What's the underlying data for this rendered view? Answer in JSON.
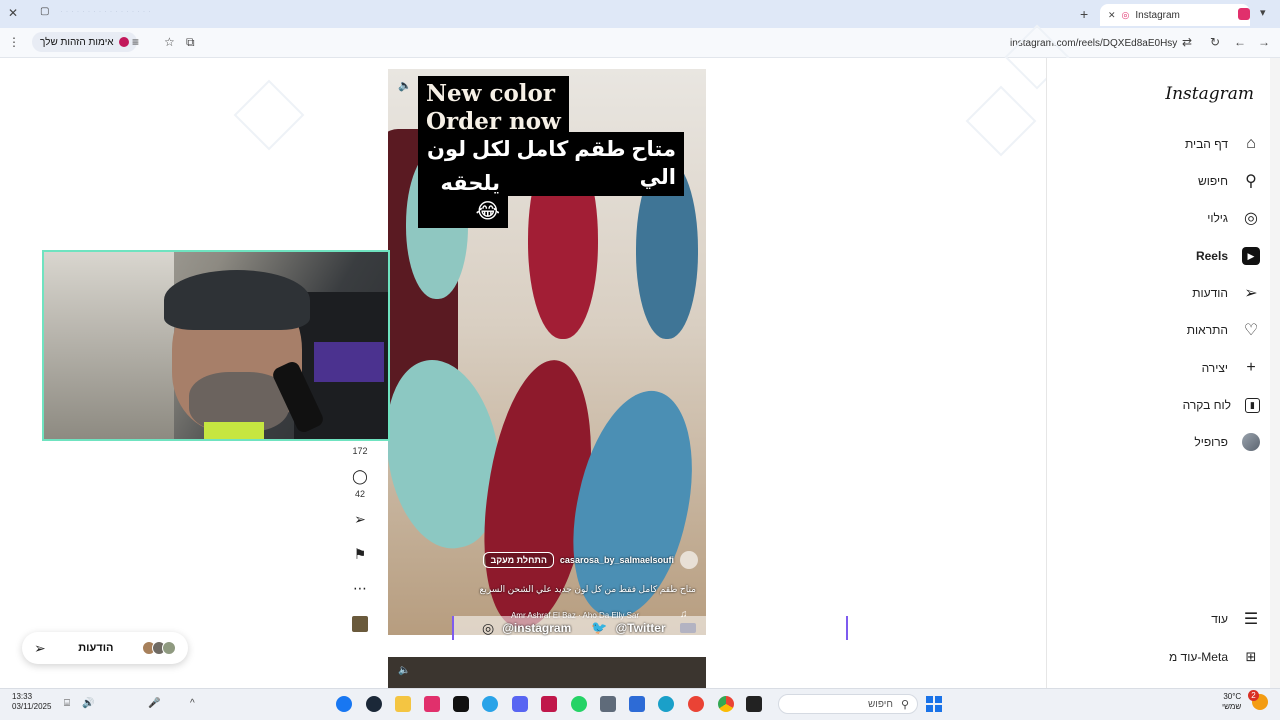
{
  "browser": {
    "tab_title": "Instagram",
    "url": "instagram.com/reels/DQXEd8aE0Hsy",
    "identity_pill": "אימות הזהות שלך"
  },
  "sidebar": {
    "logo": "Instagram",
    "items": [
      {
        "label": "דף הבית",
        "icon": "home-icon"
      },
      {
        "label": "חיפוש",
        "icon": "search-icon"
      },
      {
        "label": "גילוי",
        "icon": "compass-icon"
      },
      {
        "label": "Reels",
        "icon": "reels-icon",
        "active": true
      },
      {
        "label": "הודעות",
        "icon": "send-icon"
      },
      {
        "label": "התראות",
        "icon": "heart-icon"
      },
      {
        "label": "יצירה",
        "icon": "plus-icon"
      },
      {
        "label": "לוח בקרה",
        "icon": "dashboard-icon"
      },
      {
        "label": "פרופיל",
        "icon": "avatar-icon"
      }
    ],
    "more": "עוד",
    "meta_more": "עוד מ-Meta"
  },
  "reel": {
    "caption_en_1": "New color",
    "caption_en_2": "Order now",
    "caption_he_1": "متاح طقم كامل لكل لون الي",
    "caption_he_2": "يلحقه😂",
    "username": "casarosa_by_salmaelsoufi",
    "follow": "התחלת מעקב",
    "description": "متاح طقم كامل فقط من كل لون جديد علي الشحن السريع",
    "audio": "Amr Ashraf El Baz · Aho Da Elly Sar",
    "watermark_instagram": "@instagram",
    "watermark_twitter": "@Twitter"
  },
  "actions": {
    "likes": "172",
    "comments": "42"
  },
  "messages_pill": {
    "label": "הודעות"
  },
  "taskbar": {
    "time": "13:33",
    "date": "03/11/2025",
    "search_placeholder": "חיפוש",
    "weather_temp": "30°C",
    "weather_text": "שמשי",
    "notification_count": "2"
  },
  "colors": {
    "accent_teal": "#6fe3c0",
    "instagram_pink": "#e1306c",
    "red_velvet": "#8e1a2c",
    "blue_velvet": "#4b8fb4",
    "teal_velvet": "#8fc7c1"
  }
}
